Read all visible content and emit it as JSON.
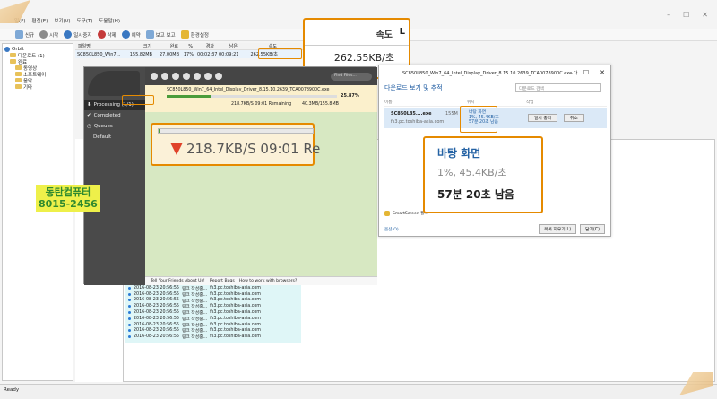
{
  "main_window": {
    "menu": [
      "일(F)",
      "편집(E)",
      "보기(V)",
      "도구(T)",
      "도움말(H)"
    ],
    "toolbar": [
      "신규",
      "시작",
      "일시중지",
      "삭제",
      "예약",
      "보고 보고",
      "환경설정"
    ],
    "tree": [
      {
        "label": "Orbit",
        "level": 0
      },
      {
        "label": "다운로드 (1)",
        "level": 1
      },
      {
        "label": "완료",
        "level": 1
      },
      {
        "label": "동영상",
        "level": 2
      },
      {
        "label": "소프트웨어",
        "level": 2
      },
      {
        "label": "음악",
        "level": 2
      },
      {
        "label": "기타",
        "level": 2
      }
    ],
    "columns": [
      "파일명",
      "크기",
      "완료",
      "%",
      "경과",
      "남은",
      "속도"
    ],
    "row": {
      "name": "SC850L850_Win7...",
      "size": "155.82MB",
      "done": "27.00MB",
      "pct": "17%",
      "elapsed": "00:02:37",
      "remaining": "00:09:21",
      "speed": "262.55KB/초"
    },
    "log": [
      {
        "time": "2016-08-23 20:56:55",
        "msg": "링크 작성중...",
        "host": "fs3.pc.toshiba-asia.com"
      },
      {
        "time": "2016-08-23 20:56:55",
        "msg": "링크 작성중...",
        "host": "fs3.pc.toshiba-asia.com"
      },
      {
        "time": "2016-08-23 20:56:55",
        "msg": "링크 작성중...",
        "host": "fs3.pc.toshiba-asia.com"
      },
      {
        "time": "2016-08-23 20:56:55",
        "msg": "링크 작성중...",
        "host": "fs3.pc.toshiba-asia.com"
      },
      {
        "time": "2016-08-23 20:56:55",
        "msg": "링크 작성중...",
        "host": "fs3.pc.toshiba-asia.com"
      },
      {
        "time": "2016-08-23 20:56:55",
        "msg": "링크 작성중...",
        "host": "fs3.pc.toshiba-asia.com"
      },
      {
        "time": "2016-08-23 20:56:55",
        "msg": "링크 작성중...",
        "host": "fs3.pc.toshiba-asia.com"
      },
      {
        "time": "2016-08-23 20:56:55",
        "msg": "링크 작성중...",
        "host": "fs3.pc.toshiba-asia.com"
      },
      {
        "time": "2016-08-23 20:56:55",
        "msg": "링크 작성중...",
        "host": "fs3.pc.toshiba-asia.com"
      }
    ],
    "status": "Ready",
    "win_controls": [
      "–",
      "☐",
      "✕"
    ]
  },
  "speed_callout": {
    "label": "속도",
    "value": "262.55KB/초",
    "side": "L"
  },
  "dark_app": {
    "sidebar": [
      {
        "label": "Processing (1/1)",
        "active": true
      },
      {
        "label": "Completed",
        "active": false
      },
      {
        "label": "Queues",
        "active": false
      },
      {
        "label": "Default",
        "active": false
      }
    ],
    "search_placeholder": "Find Files...",
    "item": {
      "name": "SC850L850_Win7_64_Intel_Display_Driver_8.15.10.2639_TCA0078900C.exe",
      "pct_text": "25.87%",
      "progress": 0.2587,
      "info": "218.7KB/S 09:01",
      "info_suffix": "Remaining",
      "size": "40.3MB/155.8MB"
    },
    "callout": {
      "text": "218.7KB/S 09:01 Re",
      "progress": 0.01
    },
    "footer": [
      "Tell Your Friends About Us!",
      "Report Bugs",
      "How to work with browsers?"
    ]
  },
  "dialog": {
    "title": "SC850L850_Win7_64_Intel_Display_Driver_8.15.10.2639_TCA0078900C.exe 다...",
    "controls": [
      "–",
      "☐",
      "✕"
    ],
    "heading": "다운로드 보기 및 추적",
    "search_placeholder": "다운로드 검색",
    "columns": [
      "이름",
      "위치",
      "작업"
    ],
    "row": {
      "name": "SC850L85....exe",
      "host": "fs3.pc.toshiba-asia.com",
      "size": "155M",
      "loc1": "바탕 화면",
      "loc2": "1%, 45.4KB/초",
      "loc3": "57분 20초 남음",
      "pause": "일시 중지",
      "cancel": "취소"
    },
    "smartscreen": "SmartScreen 필...",
    "options": "옵션(O)",
    "clear": "목록 지우기(L)",
    "close": "닫기(C)"
  },
  "status_callout": {
    "l1": "바탕 화면",
    "l2": "1%, 45.4KB/초",
    "l3": "57분 20초 남음"
  },
  "watermark": {
    "line1": "동탄컴퓨터",
    "line2": "8015-2456"
  }
}
